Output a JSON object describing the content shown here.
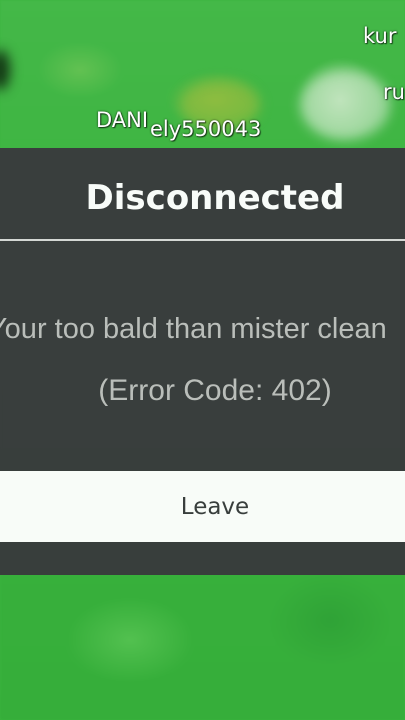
{
  "game": {
    "player_tags": [
      "DANI",
      "ely550043",
      "kur",
      "ru"
    ]
  },
  "dialog": {
    "title": "Disconnected",
    "message": "Your too bald than mister clean",
    "error_code": "(Error Code: 402)",
    "leave_label": "Leave"
  },
  "colors": {
    "dialog_bg": "#393b3d",
    "button_bg": "#ffffff",
    "game_green": "#3bb53f"
  }
}
